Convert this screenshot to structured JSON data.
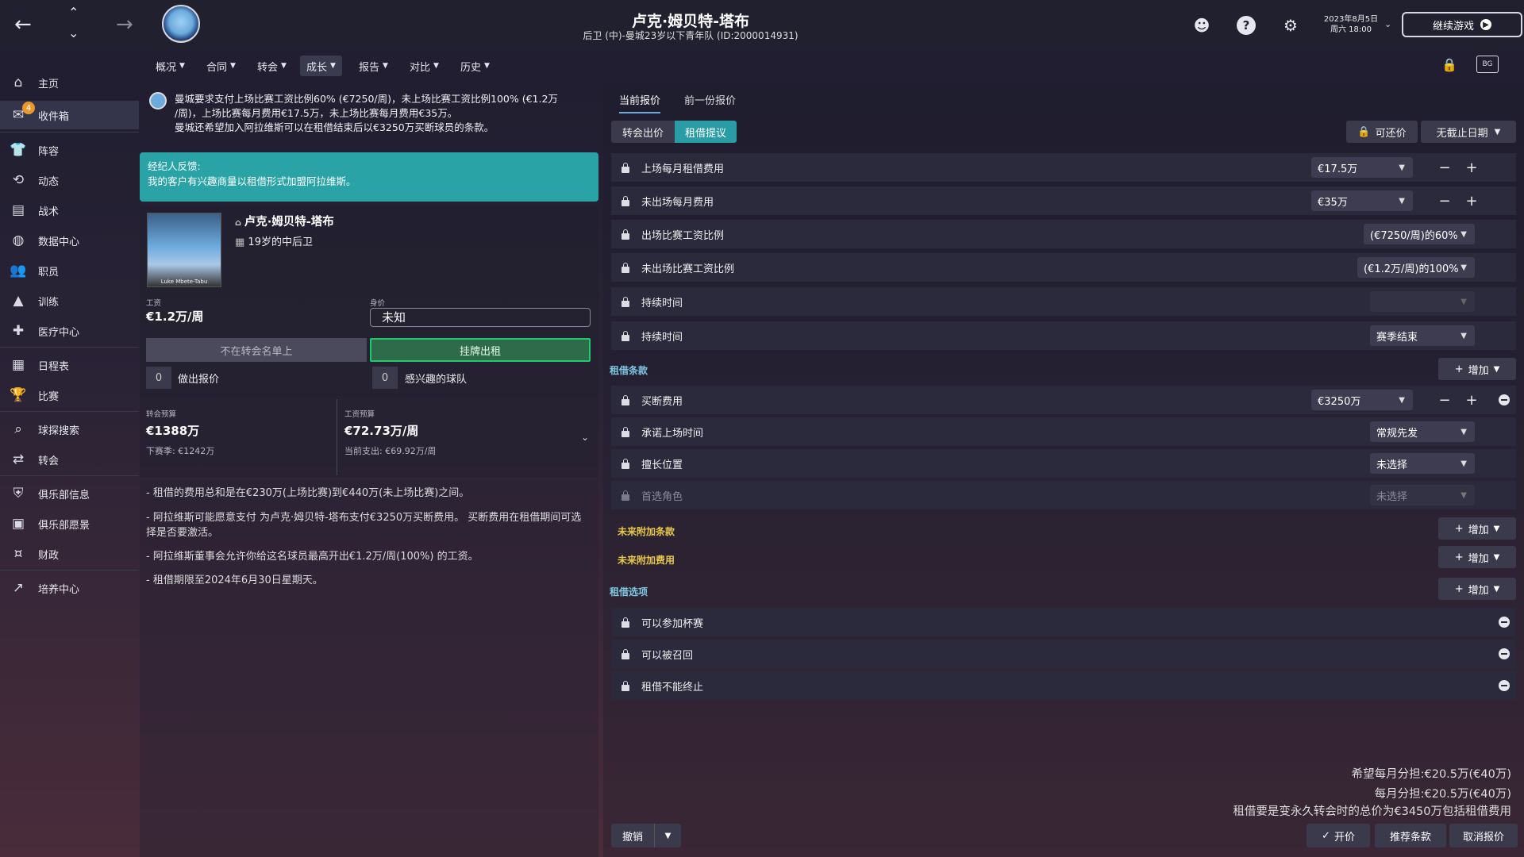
{
  "topbar": {
    "player_title": "卢克·姆贝特-塔布",
    "player_subtitle": "后卫 (中)-曼城23岁以下青年队 (ID:2000014931)",
    "date_line1": "2023年8月5日",
    "date_line2": "周六 18:00",
    "continue_label": "继续游戏",
    "icons": [
      "back-arrow-icon",
      "up-icon",
      "down-icon",
      "forward-arrow-icon",
      "club-crest",
      "assistant-icon",
      "help-icon",
      "gear-icon"
    ]
  },
  "sidebar": {
    "items": [
      {
        "label": "主页",
        "icon": "⌂"
      },
      {
        "label": "收件箱",
        "icon": "✉",
        "badge": "4"
      },
      {
        "label": "阵容",
        "icon": "👕"
      },
      {
        "label": "动态",
        "icon": "⟲"
      },
      {
        "label": "战术",
        "icon": "▤"
      },
      {
        "label": "数据中心",
        "icon": "◍"
      },
      {
        "label": "职员",
        "icon": "👥"
      },
      {
        "label": "训练",
        "icon": "▲"
      },
      {
        "label": "医疗中心",
        "icon": "✚"
      },
      {
        "label": "日程表",
        "icon": "▦"
      },
      {
        "label": "比赛",
        "icon": "🏆"
      },
      {
        "label": "球探搜索",
        "icon": "⌕"
      },
      {
        "label": "转会",
        "icon": "⇄"
      },
      {
        "label": "俱乐部信息",
        "icon": "⛨"
      },
      {
        "label": "俱乐部愿景",
        "icon": "▣"
      },
      {
        "label": "财政",
        "icon": "¤"
      },
      {
        "label": "培养中心",
        "icon": "↗"
      }
    ]
  },
  "navtabs": [
    "概况",
    "合同",
    "转会",
    "成长",
    "报告",
    "对比",
    "历史"
  ],
  "message": {
    "line1": "曼城要求支付上场比赛工资比例60% (€7250/周)，未上场比赛工资比例100% (€1.2万",
    "line2": "/周)，上场比赛每月费用€17.5万，未上场比赛每月费用€35万。",
    "line3": "曼城还希望加入阿拉维斯可以在租借结束后以€3250万买断球员的条款。"
  },
  "agent": {
    "title": "经纪人反馈:",
    "text": "我的客户有兴趣商量以租借形式加盟阿拉维斯。"
  },
  "player": {
    "name": "卢克·姆贝特-塔布",
    "desc": "19岁的中后卫",
    "photo_caption": "Luke Mbete-Tabu",
    "wage_label": "工资",
    "wage": "€1.2万/周",
    "value_label": "身价",
    "value": "未知",
    "not_listed": "不在转会名单上",
    "loan_list": "挂牌出租",
    "offers_count": "0",
    "offers_label": "做出报价",
    "interested_count": "0",
    "interested_label": "感兴趣的球队"
  },
  "budget": {
    "transfer_label": "转会预算",
    "transfer_value": "€1388万",
    "transfer_sub": "下赛季: €1242万",
    "wage_label": "工资预算",
    "wage_value": "€72.73万/周",
    "wage_sub": "当前支出: €69.92万/周"
  },
  "notes": [
    "- 租借的费用总和是在€230万(上场比赛)到€440万(未上场比赛)之间。",
    "- 阿拉维斯可能愿意支付 为卢克·姆贝特-塔布支付€3250万买断费用。 买断费用在租借期间可选择是否要激活。",
    "- 阿拉维斯董事会允许你给这名球员最高开出€1.2万/周(100%) 的工资。",
    "- 租借期限至2024年6月30日星期天。"
  ],
  "offer": {
    "tab_current": "当前报价",
    "tab_previous": "前一份报价",
    "sub_transfer": "转会出价",
    "sub_loan": "租借提议",
    "negotiable": "可还价",
    "deadline": "无截止日期",
    "rows": {
      "monthly_fee_played": {
        "label": "上场每月租借费用",
        "value": "€17.5万"
      },
      "monthly_fee_unused": {
        "label": "未出场每月费用",
        "value": "€35万"
      },
      "wage_played": {
        "label": "出场比赛工资比例",
        "value": "(€7250/周)的60%"
      },
      "wage_unused": {
        "label": "未出场比赛工资比例",
        "value": "(€1.2万/周)的100%"
      },
      "duration1": {
        "label": "持续时间",
        "value": ""
      },
      "duration2": {
        "label": "持续时间",
        "value": "赛季结束"
      },
      "buyout": {
        "label": "买断费用",
        "value": "€3250万"
      },
      "playing_time": {
        "label": "承诺上场时间",
        "value": "常规先发"
      },
      "position": {
        "label": "擅长位置",
        "value": "未选择"
      },
      "role": {
        "label": "首选角色",
        "value": "未选择"
      },
      "cup": {
        "label": "可以参加杯赛"
      },
      "recall": {
        "label": "可以被召回"
      },
      "no_terminate": {
        "label": "租借不能终止"
      }
    },
    "section_loan_terms": "租借条款",
    "section_future_clauses": "未来附加条款",
    "section_future_fees": "未来附加费用",
    "section_loan_options": "租借选项",
    "add_label": "增加",
    "summary1": "希望每月分担:€20.5万(€40万)",
    "summary2": "每月分担:€20.5万(€40万)",
    "summary3": "租借要是变永久转会时的总价为€3450万包括租借费用",
    "cancel": "撤销",
    "propose": "开价",
    "suggest": "推荐条款",
    "withdraw": "取消报价"
  },
  "colors": {
    "accent": "#29a3a6",
    "loan_green": "#22c96a",
    "section_yellow": "#e6c84a",
    "badge": "#e89a2c"
  }
}
